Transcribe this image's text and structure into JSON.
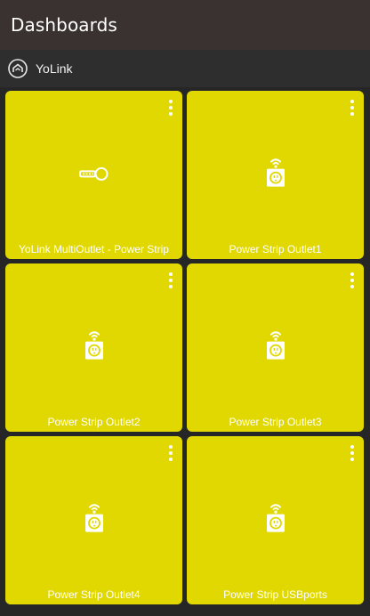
{
  "header": {
    "title": "Dashboards"
  },
  "hub": {
    "label": "YoLink"
  },
  "tiles": [
    {
      "label": "YoLink MultiOutlet - Power Strip",
      "icon": "key-icon"
    },
    {
      "label": "Power Strip Outlet1",
      "icon": "smart-outlet-icon"
    },
    {
      "label": "Power Strip Outlet2",
      "icon": "smart-outlet-icon"
    },
    {
      "label": "Power Strip Outlet3",
      "icon": "smart-outlet-icon"
    },
    {
      "label": "Power Strip Outlet4",
      "icon": "smart-outlet-icon"
    },
    {
      "label": "Power Strip USBports",
      "icon": "smart-outlet-icon"
    }
  ],
  "colors": {
    "tile": "#e0d800",
    "appbar": "#3a3230",
    "background": "#262626"
  }
}
